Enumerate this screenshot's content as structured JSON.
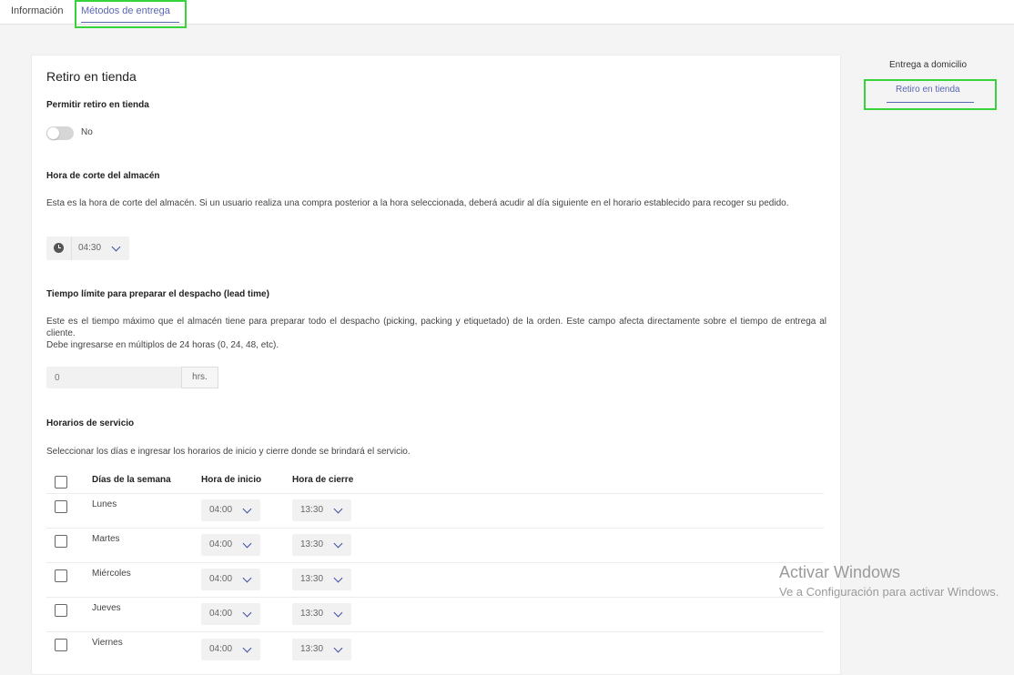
{
  "tabs": {
    "info": "Información",
    "metodos": "Métodos de entrega"
  },
  "section": {
    "title": "Retiro en tienda",
    "permitir": {
      "label": "Permitir retiro en tienda",
      "toggle_value": "No"
    },
    "corte": {
      "label": "Hora de corte del almacén",
      "description": "Esta es la hora de corte del almacén. Si un usuario realiza una compra posterior a la hora seleccionada, deberá acudir al día siguiente en el horario establecido para recoger su pedido.",
      "time": "04:30"
    },
    "lead": {
      "label": "Tiempo límite para preparar el despacho (lead time)",
      "description1": "Este es el tiempo máximo que el almacén tiene para preparar todo el despacho (picking, packing y etiquetado) de la orden. Este campo afecta directamente sobre el tiempo de entrega al cliente.",
      "description2": "Debe ingresarse en múltiplos de 24 horas (0, 24, 48, etc).",
      "placeholder": "0",
      "unit": "hrs."
    },
    "horarios": {
      "label": "Horarios de servicio",
      "description": "Seleccionar los días e ingresar los horarios de inicio y cierre donde se brindará el servicio.",
      "columns": {
        "dias": "Días de la semana",
        "inicio": "Hora de inicio",
        "cierre": "Hora de cierre"
      },
      "rows": [
        {
          "day": "Lunes",
          "start": "04:00",
          "end": "13:30"
        },
        {
          "day": "Martes",
          "start": "04:00",
          "end": "13:30"
        },
        {
          "day": "Miércoles",
          "start": "04:00",
          "end": "13:30"
        },
        {
          "day": "Jueves",
          "start": "04:00",
          "end": "13:30"
        },
        {
          "day": "Viernes",
          "start": "04:00",
          "end": "13:30"
        }
      ]
    }
  },
  "sidenav": {
    "items": [
      "Entrega a domicilio",
      "Retiro en tienda"
    ]
  },
  "watermark": {
    "line1": "Activar Windows",
    "line2": "Ve a Configuración para activar Windows."
  },
  "colors": {
    "accent": "#5a67b1",
    "highlight": "#37d33a"
  }
}
